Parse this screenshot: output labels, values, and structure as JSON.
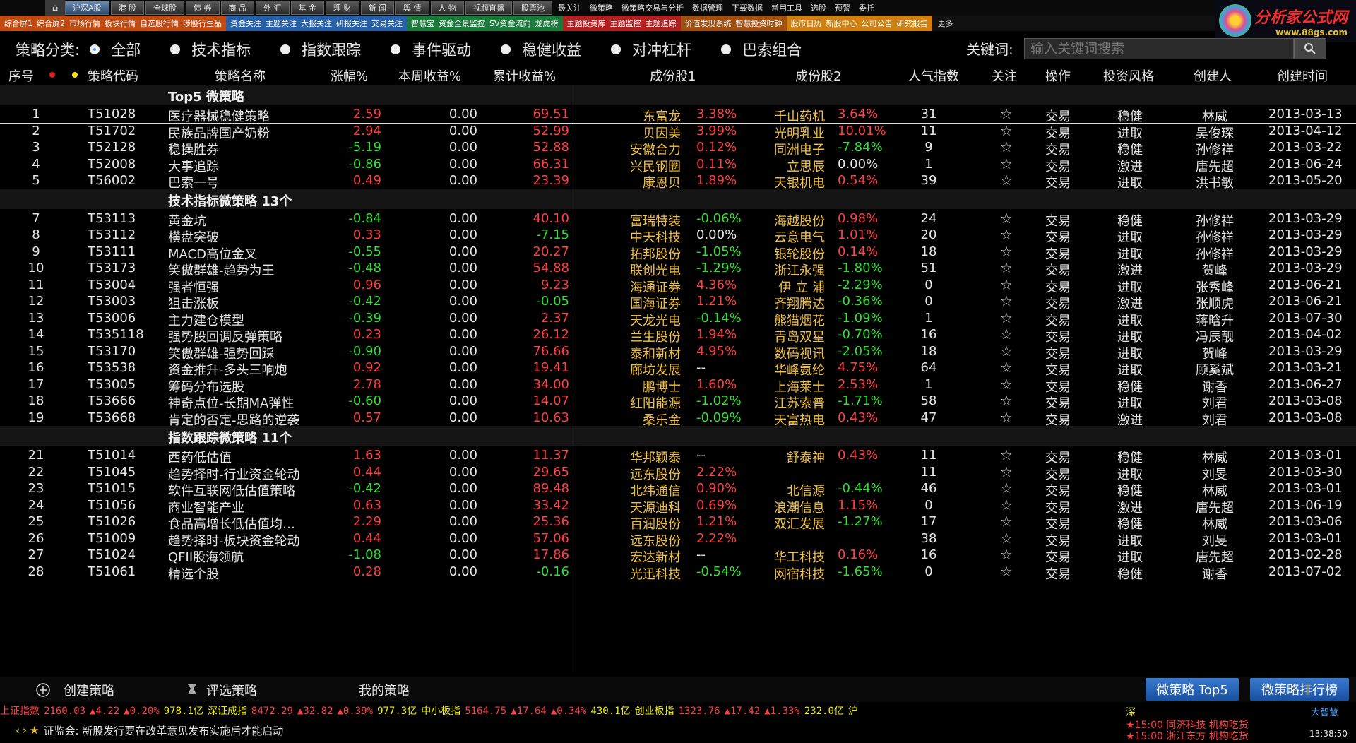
{
  "nav": {
    "tabs": [
      "沪深A股",
      "港 股",
      "全球股",
      "债 券",
      "商 品",
      "外 汇",
      "基 金",
      "理 财",
      "新 闻",
      "舆 情",
      "人 物",
      "视频直播",
      "股票池"
    ],
    "plain": [
      "最关注",
      "微策略",
      "微策略交易与分析",
      "数据管理",
      "下载数据",
      "常用工具",
      "选股",
      "预警",
      "委托"
    ],
    "groups": [
      {
        "items": [
          "综合屏1",
          "综合屏2",
          "市场行情",
          "板块行情",
          "自选股行情",
          "涉股行生品"
        ]
      },
      {
        "items": [
          "资金关注",
          "主题关注",
          "大报关注",
          "研报关注",
          "交易关注"
        ]
      },
      {
        "items": [
          "智慧宝",
          "资金全景监控",
          "SV资金流向",
          "龙虎榜"
        ]
      },
      {
        "items": [
          "主题投资库",
          "主题监控",
          "主题追踪"
        ]
      },
      {
        "items": [
          "价值发现系统",
          "智慧投资时钟"
        ]
      },
      {
        "items": [
          "股市日历",
          "新股中心",
          "公司公告",
          "研究报告"
        ]
      }
    ],
    "more": "更多"
  },
  "logo": {
    "title": "分析家公式网",
    "url_text": "www.88gs.com"
  },
  "filter": {
    "label": "策略分类:",
    "options": [
      "全部",
      "技术指标",
      "指数跟踪",
      "事件驱动",
      "稳健收益",
      "对冲杠杆",
      "巴索组合"
    ],
    "selected": 0,
    "keyword_label": "关键词:",
    "keyword_placeholder": "输入关键词搜索"
  },
  "columns": {
    "idx": "序号",
    "code": "策略代码",
    "name": "策略名称",
    "chg": "涨幅%",
    "week": "本周收益%",
    "cum": "累计收益%",
    "s1": "成份股1",
    "s2": "成份股2",
    "pop": "人气指数",
    "fav": "关注",
    "op": "操作",
    "style": "投资风格",
    "creator": "创建人",
    "date": "创建时间"
  },
  "groups": [
    {
      "title": "Top5 微策略",
      "rows": [
        [
          "1",
          "T51028",
          "医疗器械稳健策略",
          "2.59",
          "0.00",
          "69.51",
          "东富龙",
          "3.38%",
          "千山药机",
          "3.64%",
          "31",
          "交易",
          "稳健",
          "林威",
          "2013-03-13"
        ],
        [
          "2",
          "T51702",
          "民族品牌国产奶粉",
          "2.94",
          "0.00",
          "52.99",
          "贝因美",
          "3.99%",
          "光明乳业",
          "10.01%",
          "11",
          "交易",
          "进取",
          "吴俊琛",
          "2013-04-12"
        ],
        [
          "3",
          "T52128",
          "稳操胜券",
          "-5.19",
          "0.00",
          "52.88",
          "安徽合力",
          "0.12%",
          "同洲电子",
          "-7.84%",
          "9",
          "交易",
          "稳健",
          "孙修祥",
          "2013-03-22"
        ],
        [
          "4",
          "T52008",
          "大事追踪",
          "-0.86",
          "0.00",
          "66.31",
          "兴民钢圈",
          "0.11%",
          "立思辰",
          "0.00%",
          "1",
          "交易",
          "激进",
          "唐先超",
          "2013-06-24"
        ],
        [
          "5",
          "T56002",
          "巴索一号",
          "0.49",
          "0.00",
          "23.39",
          "康恩贝",
          "1.89%",
          "天银机电",
          "0.54%",
          "39",
          "交易",
          "进取",
          "洪书敏",
          "2013-05-20"
        ]
      ]
    },
    {
      "title": "技术指标微策略  13个",
      "rows": [
        [
          "7",
          "T53113",
          "黄金坑",
          "-0.84",
          "0.00",
          "40.10",
          "富瑞特装",
          "-0.06%",
          "海越股份",
          "0.98%",
          "24",
          "交易",
          "稳健",
          "孙修祥",
          "2013-03-29"
        ],
        [
          "8",
          "T53112",
          "横盘突破",
          "0.33",
          "0.00",
          "-7.15",
          "中天科技",
          "0.00%",
          "云意电气",
          "1.01%",
          "20",
          "交易",
          "进取",
          "孙修祥",
          "2013-03-29"
        ],
        [
          "9",
          "T53111",
          "MACD高位金叉",
          "-0.55",
          "0.00",
          "20.27",
          "拓邦股份",
          "-1.05%",
          "银轮股份",
          "0.14%",
          "18",
          "交易",
          "进取",
          "孙修祥",
          "2013-03-29"
        ],
        [
          "10",
          "T53173",
          "笑傲群雄-趋势为王",
          "-0.48",
          "0.00",
          "54.88",
          "联创光电",
          "-1.29%",
          "浙江永强",
          "-1.80%",
          "51",
          "交易",
          "激进",
          "贺峰",
          "2013-03-29"
        ],
        [
          "11",
          "T53004",
          "强者恒强",
          "0.96",
          "0.00",
          "9.23",
          "海通证券",
          "4.36%",
          "伊 立 浦",
          "-2.29%",
          "0",
          "交易",
          "进取",
          "张秀峰",
          "2013-06-21"
        ],
        [
          "12",
          "T53003",
          "狙击涨板",
          "-0.42",
          "0.00",
          "-0.05",
          "国海证券",
          "1.21%",
          "齐翔腾达",
          "-0.36%",
          "0",
          "交易",
          "激进",
          "张顺虎",
          "2013-06-21"
        ],
        [
          "13",
          "T53006",
          "主力建仓模型",
          "-0.39",
          "0.00",
          "2.37",
          "天龙光电",
          "-0.14%",
          "熊猫烟花",
          "-1.09%",
          "1",
          "交易",
          "进取",
          "蒋晗升",
          "2013-07-30"
        ],
        [
          "14",
          "T535118",
          "强势股回调反弹策略",
          "0.23",
          "0.00",
          "26.12",
          "兰生股份",
          "1.94%",
          "青岛双星",
          "-0.70%",
          "16",
          "交易",
          "进取",
          "冯辰靓",
          "2013-04-02"
        ],
        [
          "15",
          "T53170",
          "笑傲群雄-强势回踩",
          "-0.90",
          "0.00",
          "76.66",
          "泰和新材",
          "4.95%",
          "数码视讯",
          "-2.05%",
          "18",
          "交易",
          "进取",
          "贺峰",
          "2013-03-29"
        ],
        [
          "16",
          "T53538",
          "资金推升-多头三响炮",
          "0.92",
          "0.00",
          "19.41",
          "廊坊发展",
          "--",
          "华峰氨纶",
          "4.75%",
          "64",
          "交易",
          "进取",
          "顾奚斌",
          "2013-03-21"
        ],
        [
          "17",
          "T53005",
          "筹码分布选股",
          "2.78",
          "0.00",
          "34.00",
          "鹏博士",
          "1.60%",
          "上海莱士",
          "2.53%",
          "1",
          "交易",
          "稳健",
          "谢香",
          "2013-06-27"
        ],
        [
          "18",
          "T53666",
          "神奇点位-长期MA弹性",
          "-0.60",
          "0.00",
          "14.07",
          "红阳能源",
          "-1.02%",
          "江苏索普",
          "-1.71%",
          "58",
          "交易",
          "进取",
          "刘君",
          "2013-03-08"
        ],
        [
          "19",
          "T53668",
          "肯定的否定-思路的逆袭",
          "0.57",
          "0.00",
          "10.63",
          "桑乐金",
          "-0.09%",
          "天富热电",
          "0.43%",
          "47",
          "交易",
          "激进",
          "刘君",
          "2013-03-08"
        ]
      ]
    },
    {
      "title": "指数跟踪微策略  11个",
      "rows": [
        [
          "21",
          "T51014",
          "西药低估值",
          "1.63",
          "0.00",
          "11.37",
          "华邦颖泰",
          "--",
          "舒泰神",
          "0.43%",
          "11",
          "交易",
          "稳健",
          "林威",
          "2013-03-01"
        ],
        [
          "22",
          "T51045",
          "趋势择时-行业资金轮动",
          "0.44",
          "0.00",
          "29.65",
          "远东股份",
          "2.22%",
          "",
          "",
          "11",
          "交易",
          "进取",
          "刘旻",
          "2013-03-30"
        ],
        [
          "23",
          "T51015",
          "软件互联网低估值策略",
          "-0.42",
          "0.00",
          "89.48",
          "北纬通信",
          "0.90%",
          "北信源",
          "-0.44%",
          "46",
          "交易",
          "稳健",
          "林威",
          "2013-03-01"
        ],
        [
          "24",
          "T51056",
          "商业智能产业",
          "0.63",
          "0.00",
          "33.42",
          "天源迪科",
          "0.69%",
          "浪潮信息",
          "1.15%",
          "0",
          "交易",
          "激进",
          "唐先超",
          "2013-06-19"
        ],
        [
          "25",
          "T51026",
          "食品高增长低估值均…",
          "2.29",
          "0.00",
          "25.36",
          "百润股份",
          "1.21%",
          "双汇发展",
          "-1.27%",
          "17",
          "交易",
          "稳健",
          "林威",
          "2013-03-06"
        ],
        [
          "26",
          "T51009",
          "趋势择时-板块资金轮动",
          "0.44",
          "0.00",
          "57.06",
          "远东股份",
          "2.22%",
          "",
          "",
          "38",
          "交易",
          "进取",
          "刘旻",
          "2013-03-01"
        ],
        [
          "27",
          "T51024",
          "QFII股海领航",
          "-1.08",
          "0.00",
          "17.86",
          "宏达新材",
          "--",
          "华工科技",
          "0.16%",
          "16",
          "交易",
          "进取",
          "唐先超",
          "2013-02-28"
        ],
        [
          "28",
          "T51061",
          "精选个股",
          "0.28",
          "0.00",
          "-0.16",
          "光迅科技",
          "-0.54%",
          "网宿科技",
          "-1.65%",
          "0",
          "交易",
          "稳健",
          "谢香",
          "2013-07-02"
        ]
      ]
    }
  ],
  "bottom": {
    "create": "创建策略",
    "review": "评选策略",
    "mine": "我的策略",
    "btn_top5": "微策略 Top5",
    "btn_rank": "微策略排行榜"
  },
  "ticker": [
    {
      "t": "上证指数",
      "c": "#ff4040"
    },
    {
      "t": "2160.03",
      "c": "#ff4040"
    },
    {
      "t": "▲4.22",
      "c": "#ff4040"
    },
    {
      "t": "▲0.20%",
      "c": "#ff4040"
    },
    {
      "t": "978.1亿",
      "c": "#f0f000"
    },
    {
      "t": "深证成指",
      "c": "#f0f000"
    },
    {
      "t": "8472.29",
      "c": "#ff4040"
    },
    {
      "t": "▲32.82",
      "c": "#ff4040"
    },
    {
      "t": "▲0.39%",
      "c": "#ff4040"
    },
    {
      "t": "977.3亿",
      "c": "#f0f000"
    },
    {
      "t": "中小板指",
      "c": "#f0f000"
    },
    {
      "t": "5164.75",
      "c": "#ff4040"
    },
    {
      "t": "▲17.64",
      "c": "#ff4040"
    },
    {
      "t": "▲0.34%",
      "c": "#ff4040"
    },
    {
      "t": "430.1亿",
      "c": "#f0f000"
    },
    {
      "t": "创业板指",
      "c": "#f0f000"
    },
    {
      "t": "1323.76",
      "c": "#ff4040"
    },
    {
      "t": "▲17.42",
      "c": "#ff4040"
    },
    {
      "t": "▲1.33%",
      "c": "#ff4040"
    },
    {
      "t": "232.0亿",
      "c": "#f0f000"
    },
    {
      "t": "沪",
      "c": "#f0f000"
    }
  ],
  "news": "证监会: 新股发行要在改革意见发布实施后才能启动",
  "alerts": [
    "★15:00  同济科技  机构吃货",
    "★15:00  浙江东方  机构吃货"
  ],
  "clock": "13:38:50",
  "brand_small": "大智慧",
  "right_ticker": "深"
}
